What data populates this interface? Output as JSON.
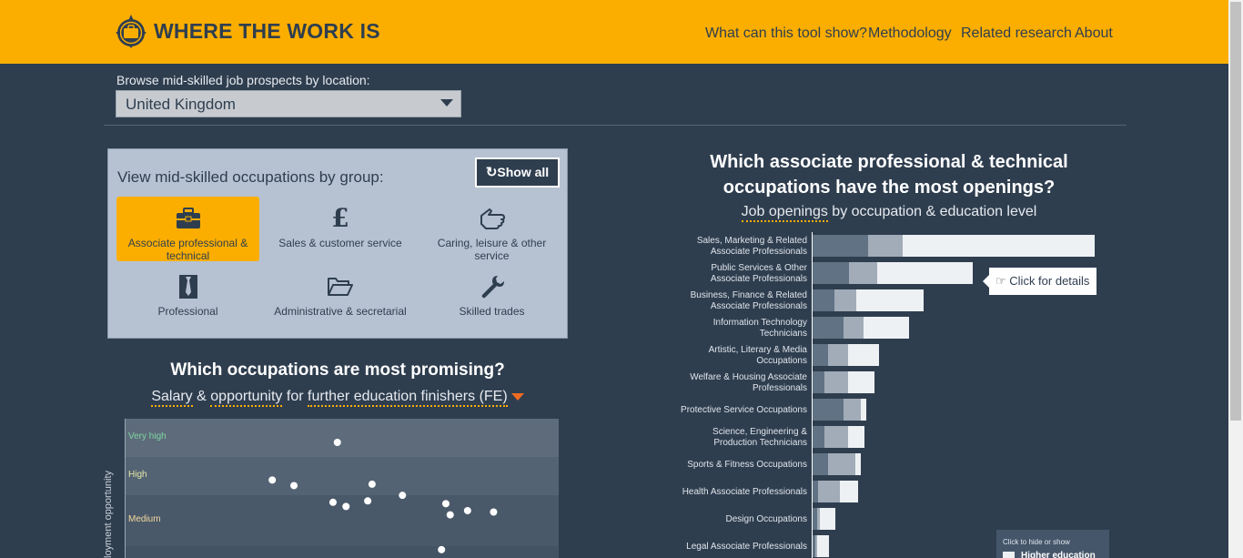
{
  "header": {
    "brand": "WHERE THE WORK IS",
    "nav": [
      "What can this tool show?",
      "Methodology",
      "Related research",
      "About"
    ]
  },
  "location": {
    "label": "Browse mid-skilled job prospects by location:",
    "selected": "United Kingdom"
  },
  "groups": {
    "title": "View mid-skilled occupations by group:",
    "show_all": "Show all",
    "items": [
      {
        "label": "Associate professional & technical",
        "icon": "briefcase-icon",
        "active": true
      },
      {
        "label": "Sales & customer service",
        "icon": "pound-icon",
        "active": false
      },
      {
        "label": "Caring, leisure & other service",
        "icon": "hand-icon",
        "active": false
      },
      {
        "label": "Professional",
        "icon": "tie-icon",
        "active": false
      },
      {
        "label": "Administrative & secretarial",
        "icon": "folder-icon",
        "active": false
      },
      {
        "label": "Skilled trades",
        "icon": "wrench-icon",
        "active": false
      }
    ]
  },
  "promising": {
    "title": "Which occupations are most promising?",
    "sub_salary": "Salary",
    "sub_amp": "&",
    "sub_opportunity": "opportunity",
    "sub_for": "for",
    "sub_audience": "further education finishers (FE)",
    "y_axis_label": "loyment opportunity",
    "bands": [
      "Very high",
      "High",
      "Medium"
    ],
    "band_colors": [
      "#7fd6a1",
      "#e4e8a6",
      "#f3d9a0"
    ]
  },
  "openings": {
    "title": "Which associate professional & technical occupations have the most openings?",
    "sub_link": "Job openings",
    "sub_rest": "by occupation & education level",
    "tooltip": "Click for details",
    "legend_hint": "Click to hide or show",
    "legend_item": "Higher education",
    "colors": {
      "dark": "#607284",
      "mid": "#a1acb8",
      "light": "#eef1f4"
    }
  },
  "chart_data": [
    {
      "type": "bar",
      "stacked": true,
      "orientation": "horizontal",
      "categories": [
        "Sales, Marketing & Related Associate Professionals",
        "Public Services & Other Associate Professionals",
        "Business, Finance & Related Associate Professionals",
        "Information Technology Technicians",
        "Artistic, Literary & Media Occupations",
        "Welfare & Housing Associate Professionals",
        "Protective Service Occupations",
        "Science, Engineering & Production Technicians",
        "Sports & Fitness Occupations",
        "Health Associate Professionals",
        "Design Occupations",
        "Legal Associate Professionals"
      ],
      "series": [
        {
          "values": [
            61,
            40,
            24,
            34,
            17,
            13,
            34,
            13,
            17,
            6,
            5,
            3
          ]
        },
        {
          "values": [
            38,
            31,
            24,
            22,
            22,
            26,
            19,
            26,
            30,
            24,
            3,
            2
          ]
        },
        {
          "values": [
            211,
            105,
            74,
            50,
            34,
            29,
            6,
            18,
            6,
            20,
            17,
            13
          ]
        }
      ]
    },
    {
      "type": "scatter",
      "title": "Which occupations are most promising?",
      "y_bands": [
        "Very high",
        "High",
        "Medium"
      ],
      "points": [
        {
          "x": 0.49,
          "y": 0.83
        },
        {
          "x": 0.34,
          "y": 0.56
        },
        {
          "x": 0.39,
          "y": 0.52
        },
        {
          "x": 0.57,
          "y": 0.53
        },
        {
          "x": 0.64,
          "y": 0.45
        },
        {
          "x": 0.48,
          "y": 0.4
        },
        {
          "x": 0.51,
          "y": 0.37
        },
        {
          "x": 0.56,
          "y": 0.41
        },
        {
          "x": 0.74,
          "y": 0.39
        },
        {
          "x": 0.75,
          "y": 0.31
        },
        {
          "x": 0.79,
          "y": 0.34
        },
        {
          "x": 0.85,
          "y": 0.33
        },
        {
          "x": 0.73,
          "y": 0.06
        }
      ]
    }
  ]
}
